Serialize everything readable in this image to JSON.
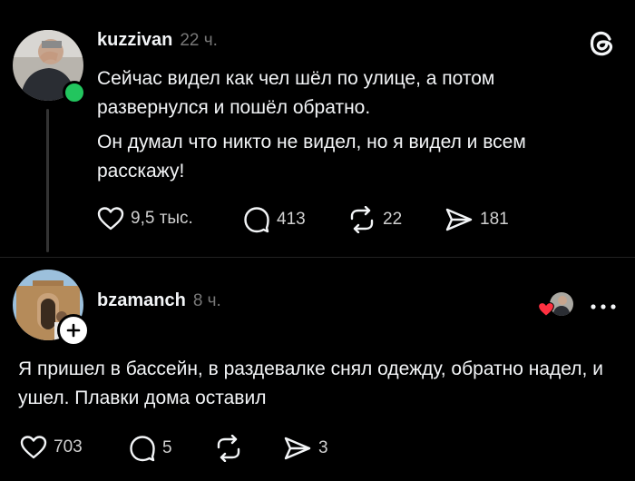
{
  "post": {
    "username": "kuzzivan",
    "time": "22 ч.",
    "paragraphs": [
      "Сейчас видел как чел шёл по улице, а потом развернулся и пошёл обратно.",
      "Он думал что никто не видел, но я видел и всем расскажу!"
    ],
    "likes": "9,5 тыс.",
    "replies": "413",
    "reposts": "22",
    "shares": "181",
    "online_color": "#22c55e"
  },
  "reply": {
    "username": "bzamanch",
    "time": "8 ч.",
    "text": "Я пришел в бассейн, в раздевалке снял одежду, обратно надел, и ушел. Плавки дома оставил",
    "likes": "703",
    "replies": "5",
    "shares": "3",
    "heart_color": "#ff3040"
  },
  "icons": [
    "threads-logo-icon",
    "heart-icon",
    "comment-icon",
    "repost-icon",
    "send-icon",
    "more-icon",
    "follow-plus-icon"
  ]
}
